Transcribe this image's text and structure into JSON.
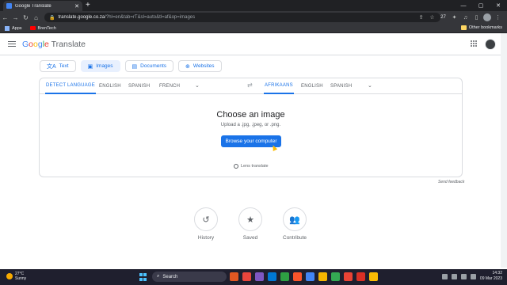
{
  "browser": {
    "tab_title": "Google Translate",
    "url_host": "translate.google.co.za",
    "url_path": "/?hl=en&tab=rT&sl=auto&tl=af&op=images",
    "extension_count": "27",
    "bookmarks": [
      {
        "label": "Apps"
      },
      {
        "label": "BrenTech"
      }
    ],
    "other_bookmarks": "Other bookmarks"
  },
  "header": {
    "logo_parts": [
      "G",
      "o",
      "o",
      "g",
      "l",
      "e"
    ],
    "logo_product": "Translate"
  },
  "modes": [
    {
      "label": "Text",
      "icon": "translate-icon",
      "glyph": "文A"
    },
    {
      "label": "Images",
      "icon": "image-icon",
      "glyph": "▣"
    },
    {
      "label": "Documents",
      "icon": "document-icon",
      "glyph": "▤"
    },
    {
      "label": "Websites",
      "icon": "globe-icon",
      "glyph": "⊕"
    }
  ],
  "source_langs": [
    "DETECT LANGUAGE",
    "ENGLISH",
    "SPANISH",
    "FRENCH"
  ],
  "target_langs": [
    "AFRIKAANS",
    "ENGLISH",
    "SPANISH"
  ],
  "upload": {
    "heading": "Choose an image",
    "hint": "Upload a .jpg, .jpeg, or .png.",
    "button": "Browse your computer",
    "lens": "Lens translate"
  },
  "feedback": "Send feedback",
  "shortcuts": [
    {
      "label": "History",
      "icon": "history-icon",
      "glyph": "↺"
    },
    {
      "label": "Saved",
      "icon": "star-icon",
      "glyph": "★"
    },
    {
      "label": "Contribute",
      "icon": "people-icon",
      "glyph": "👥"
    }
  ],
  "taskbar": {
    "temp": "27°C",
    "condition": "Sunny",
    "search": "Search",
    "time": "14:32",
    "date": "09 Mar 2023"
  },
  "colors": {
    "accent": "#1a73e8",
    "active_chip": "#e8f0fe"
  }
}
